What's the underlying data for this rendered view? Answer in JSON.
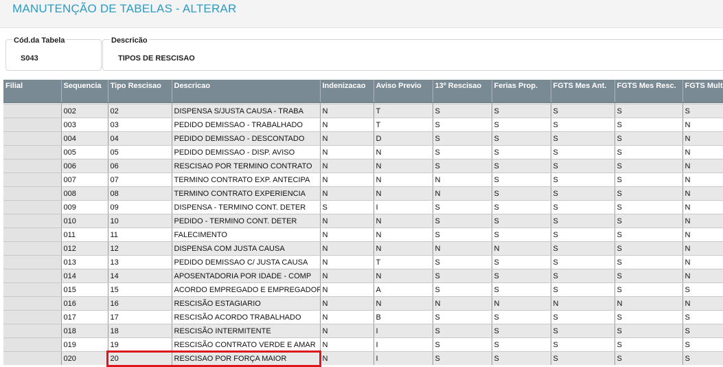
{
  "header": {
    "title": "MANUTENÇÃO DE TABELAS - ALTERAR"
  },
  "form": {
    "cod_label": "Cód.da Tabela",
    "cod_value": "S043",
    "desc_label": "Descricão",
    "desc_value": "TIPOS DE RESCISAO"
  },
  "grid": {
    "columns": [
      "Filial",
      "Sequencia",
      "Tipo Rescisao",
      "Descricao",
      "Indenizacao",
      "Aviso Previo",
      "13º Rescisao",
      "Ferias Prop.",
      "FGTS Mes Ant.",
      "FGTS Mes Resc.",
      "FGTS Multa"
    ],
    "rows": [
      [
        "",
        "002",
        "02",
        "DISPENSA S/JUSTA CAUSA - TRABA",
        "N",
        "T",
        "S",
        "S",
        "S",
        "S",
        "S"
      ],
      [
        "",
        "003",
        "03",
        "PEDIDO DEMISSAO - TRABALHADO",
        "N",
        "T",
        "S",
        "S",
        "S",
        "S",
        "N"
      ],
      [
        "",
        "004",
        "04",
        "PEDIDO DEMISSAO - DESCONTADO",
        "N",
        "D",
        "S",
        "S",
        "S",
        "S",
        "N"
      ],
      [
        "",
        "005",
        "05",
        "PEDIDO DEMISSAO - DISP. AVISO",
        "N",
        "N",
        "S",
        "S",
        "S",
        "S",
        "N"
      ],
      [
        "",
        "006",
        "06",
        "RESCISAO POR TERMINO CONTRATO",
        "N",
        "N",
        "S",
        "S",
        "S",
        "S",
        "N"
      ],
      [
        "",
        "007",
        "07",
        "TERMINO CONTRATO EXP. ANTECIPA",
        "N",
        "N",
        "N",
        "S",
        "S",
        "S",
        "N"
      ],
      [
        "",
        "008",
        "08",
        "TERMINO CONTRATO EXPERIENCIA",
        "N",
        "N",
        "N",
        "S",
        "S",
        "S",
        "N"
      ],
      [
        "",
        "009",
        "09",
        "DISPENSA - TERMINO CONT. DETER",
        "S",
        "I",
        "S",
        "S",
        "S",
        "S",
        "N"
      ],
      [
        "",
        "010",
        "10",
        "PEDIDO - TERMINO CONT. DETER",
        "N",
        "N",
        "S",
        "S",
        "S",
        "S",
        "N"
      ],
      [
        "",
        "011",
        "11",
        "FALECIMENTO",
        "N",
        "N",
        "S",
        "S",
        "S",
        "S",
        "N"
      ],
      [
        "",
        "012",
        "12",
        "DISPENSA COM JUSTA CAUSA",
        "N",
        "N",
        "N",
        "N",
        "S",
        "S",
        "N"
      ],
      [
        "",
        "013",
        "13",
        "PEDIDO DEMISSAO C/ JUSTA CAUSA",
        "N",
        "T",
        "S",
        "S",
        "S",
        "S",
        "N"
      ],
      [
        "",
        "014",
        "14",
        "APOSENTADORIA POR IDADE - COMP",
        "N",
        "N",
        "S",
        "S",
        "S",
        "S",
        "N"
      ],
      [
        "",
        "015",
        "15",
        "ACORDO EMPREGADO E EMPREGADOR",
        "N",
        "A",
        "S",
        "S",
        "S",
        "S",
        "S"
      ],
      [
        "",
        "016",
        "16",
        "RESCISÃO ESTAGIARIO",
        "N",
        "N",
        "N",
        "N",
        "N",
        "N",
        "N"
      ],
      [
        "",
        "017",
        "17",
        "RESCISÃO ACORDO TRABALHADO",
        "N",
        "B",
        "S",
        "S",
        "S",
        "S",
        "S"
      ],
      [
        "",
        "018",
        "18",
        "RESCISÃO INTERMITENTE",
        "N",
        "I",
        "S",
        "S",
        "S",
        "S",
        "S"
      ],
      [
        "",
        "019",
        "19",
        "RESCISÃO CONTRATO VERDE E AMAR",
        "N",
        "I",
        "S",
        "S",
        "S",
        "S",
        "S"
      ],
      [
        "",
        "020",
        "20",
        "RESCISAO POR FORÇA MAIOR",
        "N",
        "I",
        "S",
        "S",
        "S",
        "S",
        "S"
      ]
    ]
  },
  "highlight_color": "#e0161f"
}
